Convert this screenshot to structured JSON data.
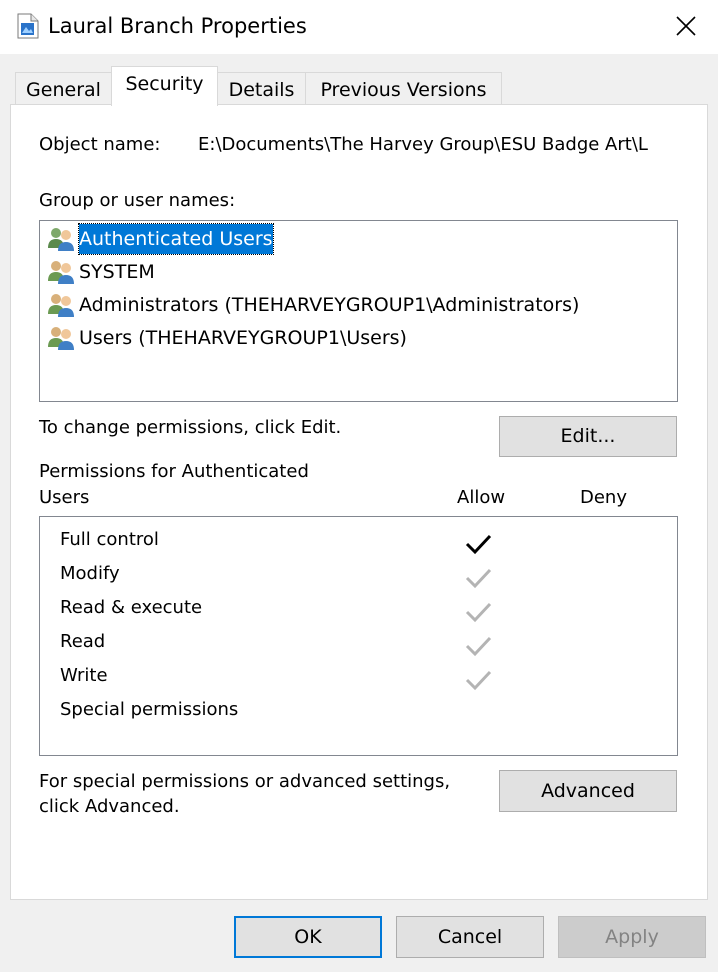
{
  "window": {
    "title": "Laural Branch Properties",
    "close_label": "✕"
  },
  "tabs": [
    {
      "label": "General",
      "active": false
    },
    {
      "label": "Security",
      "active": true
    },
    {
      "label": "Details",
      "active": false
    },
    {
      "label": "Previous Versions",
      "active": false
    }
  ],
  "security": {
    "object_name_label": "Object name:",
    "object_name_value": "E:\\Documents\\The Harvey Group\\ESU Badge Art\\L",
    "group_label": "Group or user names:",
    "users": [
      {
        "name": "Authenticated Users",
        "selected": true,
        "icon": "users-group-icon"
      },
      {
        "name": "SYSTEM",
        "selected": false,
        "icon": "users-group-icon"
      },
      {
        "name": "Administrators (THEHARVEYGROUP1\\Administrators)",
        "selected": false,
        "icon": "users-group-icon"
      },
      {
        "name": "Users (THEHARVEYGROUP1\\Users)",
        "selected": false,
        "icon": "users-group-icon"
      }
    ],
    "change_hint": "To change permissions, click Edit.",
    "edit_button": "Edit...",
    "permissions_for_line1": "Permissions for Authenticated",
    "permissions_for_line2": "Users",
    "allow_header": "Allow",
    "deny_header": "Deny",
    "permissions": [
      {
        "name": "Full control",
        "allow": "explicit",
        "deny": ""
      },
      {
        "name": "Modify",
        "allow": "inherited",
        "deny": ""
      },
      {
        "name": "Read & execute",
        "allow": "inherited",
        "deny": ""
      },
      {
        "name": "Read",
        "allow": "inherited",
        "deny": ""
      },
      {
        "name": "Write",
        "allow": "inherited",
        "deny": ""
      },
      {
        "name": "Special permissions",
        "allow": "",
        "deny": ""
      }
    ],
    "advanced_hint_line1": "For special permissions or advanced settings,",
    "advanced_hint_line2": "click Advanced.",
    "advanced_button": "Advanced"
  },
  "footer": {
    "ok": "OK",
    "cancel": "Cancel",
    "apply": "Apply"
  },
  "colors": {
    "selection": "#0078d7",
    "check_explicit": "#000000",
    "check_inherited": "#b4b4b4",
    "window_bg": "#f0f0f0"
  }
}
